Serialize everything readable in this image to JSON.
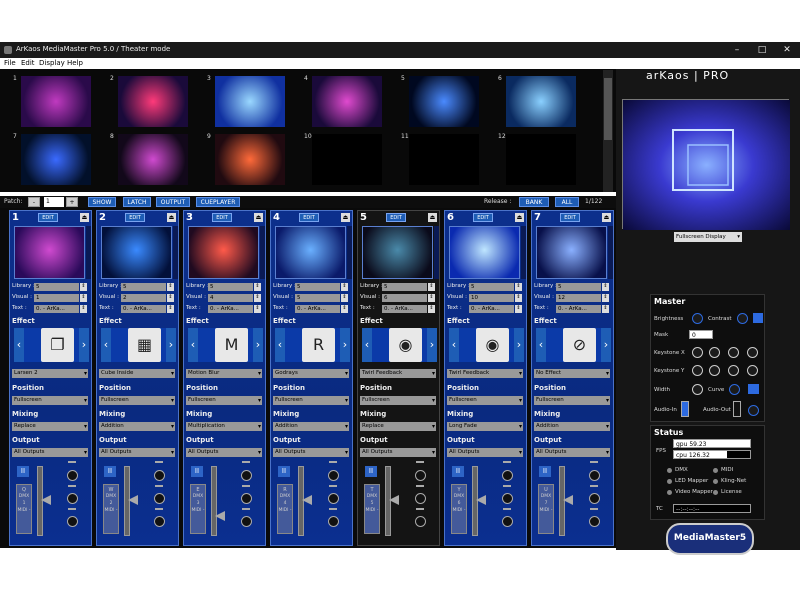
{
  "window": {
    "title": "ArKaos MediaMaster Pro 5.0  / Theater mode",
    "controls": [
      "–",
      "□",
      "✕"
    ]
  },
  "menu": [
    "File",
    "Edit",
    "Display",
    "Help"
  ],
  "thumbnails": [
    {
      "n": "1",
      "c1": "#c03ac0",
      "c2": "#2a0a4a"
    },
    {
      "n": "2",
      "c1": "#ff3a7a",
      "c2": "#1a0a3a"
    },
    {
      "n": "3",
      "c1": "#9ad8ff",
      "c2": "#1030a0"
    },
    {
      "n": "4",
      "c1": "#e04acf",
      "c2": "#1a0a3a"
    },
    {
      "n": "5",
      "c1": "#4a8aff",
      "c2": "#000820"
    },
    {
      "n": "6",
      "c1": "#8ad0ff",
      "c2": "#0a2a60"
    },
    {
      "n": "7",
      "c1": "#3a6aff",
      "c2": "#02102a"
    },
    {
      "n": "8",
      "c1": "#d04ad0",
      "c2": "#12081a"
    },
    {
      "n": "9",
      "c1": "#ff6a3a",
      "c2": "#200a10"
    },
    {
      "n": "10",
      "c1": "#000",
      "c2": "#000"
    },
    {
      "n": "11",
      "c1": "#000",
      "c2": "#000"
    },
    {
      "n": "12",
      "c1": "#000",
      "c2": "#000"
    }
  ],
  "patch": {
    "label": "Patch:",
    "minus": "-",
    "value": "1",
    "plus": "+",
    "show": "SHOW",
    "latch": "LATCH",
    "output": "OUTPUT",
    "cueplayer": "CUEPLAYER",
    "release": "Release :",
    "bank": "BANK",
    "all": "ALL",
    "count": "1/122"
  },
  "labels": {
    "edit": "EDIT",
    "library": "Library :",
    "visual": "Visual :",
    "text": "Text :",
    "effect": "Effect",
    "position": "Position",
    "mixing": "Mixing",
    "output": "Output",
    "eject": "⏏",
    "pause": "II"
  },
  "channels": [
    {
      "num": "1",
      "library": "5",
      "visual": "1",
      "text": "0. - ArKa...",
      "effect": "Larsen 2",
      "position": "Fullscreen",
      "mixing": "Replace",
      "output": "All Outputs",
      "icon": "❐",
      "key": "Q",
      "dmx": "DMX 1 MIDI -",
      "c1": "#d04ad0",
      "c2": "#2a0a5a",
      "dark": false
    },
    {
      "num": "2",
      "library": "5",
      "visual": "2",
      "text": "0. - ArKa...",
      "effect": "Cube Inside",
      "position": "Fullscreen",
      "mixing": "Addition",
      "output": "All Outputs",
      "icon": "▦",
      "key": "W",
      "dmx": "DMX 2 MIDI -",
      "c1": "#3a8aff",
      "c2": "#02103a",
      "dark": false
    },
    {
      "num": "3",
      "library": "5",
      "visual": "4",
      "text": "0. - ArKa...",
      "effect": "Motion Blur",
      "position": "Fullscreen",
      "mixing": "Multiplication",
      "output": "All Outputs",
      "icon": "M",
      "key": "E",
      "dmx": "DMX 3 MIDI -",
      "c1": "#ff5a4a",
      "c2": "#200a20",
      "dark": false
    },
    {
      "num": "4",
      "library": "5",
      "visual": "5",
      "text": "0. - ArKa...",
      "effect": "Godrays",
      "position": "Fullscreen",
      "mixing": "Addition",
      "output": "All Outputs",
      "icon": "R",
      "key": "R",
      "dmx": "DMX 4 MIDI -",
      "c1": "#6ab0ff",
      "c2": "#0a1a6a",
      "dark": false
    },
    {
      "num": "5",
      "library": "5",
      "visual": "6",
      "text": "0. - ArKa...",
      "effect": "Twirl Feedback",
      "position": "Fullscreen",
      "mixing": "Replace",
      "output": "All Outputs",
      "icon": "◉",
      "key": "T",
      "dmx": "DMX 5 MIDI -",
      "c1": "#4a8aaa",
      "c2": "#0a0a1a",
      "dark": true
    },
    {
      "num": "6",
      "library": "5",
      "visual": "10",
      "text": "0. - ArKa...",
      "effect": "Twirl Feedback",
      "position": "Fullscreen",
      "mixing": "Long Fade",
      "output": "All Outputs",
      "icon": "◉",
      "key": "Y",
      "dmx": "DMX 6 MIDI -",
      "c1": "#bfe6ff",
      "c2": "#0a2ab0",
      "dark": false
    },
    {
      "num": "7",
      "library": "5",
      "visual": "12",
      "text": "0. - ArKa...",
      "effect": "No Effect",
      "position": "Fullscreen",
      "mixing": "Addition",
      "output": "All Outputs",
      "icon": "⊘",
      "key": "U",
      "dmx": "DMX 7 MIDI -",
      "c1": "#8ab0ff",
      "c2": "#08104a",
      "dark": false
    }
  ],
  "right": {
    "logo": "arKaos | PRO",
    "display": "Fullscreen Display"
  },
  "master": {
    "title": "Master",
    "brightness": "Brightness",
    "contrast": "Contrast",
    "mask": "Mask",
    "mask_value": "0",
    "keystone_x": "Keystone X",
    "keystone_y": "Keystone Y",
    "width": "Width",
    "curve": "Curve",
    "audio_in": "Audio-In",
    "audio_out": "Audio-Out"
  },
  "status": {
    "title": "Status",
    "fps": "FPS",
    "gpu": "gpu 59.23",
    "cpu": "cpu 126.32",
    "dmx": "DMX",
    "midi": "MIDI",
    "led": "LED Mapper",
    "kling": "Kling-Net",
    "video": "Video Mapper",
    "license": "License",
    "tc": "TC",
    "tc_value": "--:--:--:--"
  },
  "brand": {
    "text": "MediaMaster5 pro"
  }
}
